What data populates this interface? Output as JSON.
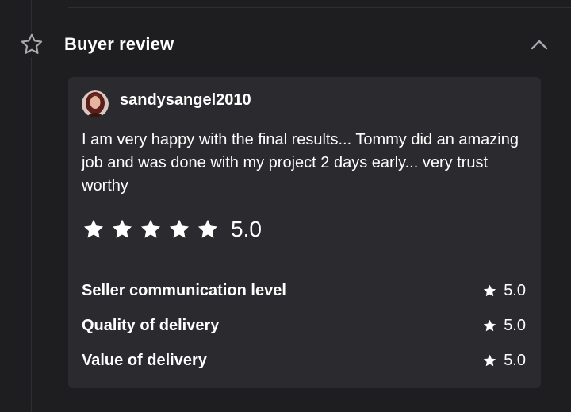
{
  "section": {
    "title": "Buyer review",
    "icon": "star-outline-icon",
    "collapse_icon": "chevron-up-icon"
  },
  "review": {
    "username": "sandysangel2010",
    "text": "I am very happy with the final results... Tommy did an amazing job and was done with my project 2 days early... very trust worthy",
    "overall_rating": 5.0,
    "overall_rating_label": "5.0",
    "stars_filled": 5,
    "sub_ratings": [
      {
        "label": "Seller communication level",
        "score": "5.0"
      },
      {
        "label": "Quality of delivery",
        "score": "5.0"
      },
      {
        "label": "Value of delivery",
        "score": "5.0"
      }
    ]
  },
  "colors": {
    "background": "#1e1e20",
    "card": "#2b2b2f",
    "text": "#ffffff",
    "star": "#ffffff",
    "muted_icon": "#a8a8ad"
  }
}
